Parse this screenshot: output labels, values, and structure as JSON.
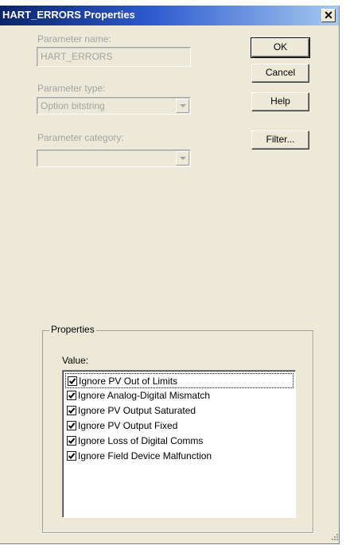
{
  "window": {
    "title": "HART_ERRORS Properties",
    "close_symbol": "✕"
  },
  "form": {
    "param_name_label": "Parameter name:",
    "param_name_value": "HART_ERRORS",
    "param_type_label": "Parameter type:",
    "param_type_value": "Option bitstring",
    "param_category_label": "Parameter category:",
    "param_category_value": ""
  },
  "buttons": {
    "ok": "OK",
    "cancel": "Cancel",
    "help": "Help",
    "filter": "Filter..."
  },
  "properties": {
    "group_title": "Properties",
    "value_label": "Value:",
    "items": [
      {
        "label": "Ignore PV Out of Limits",
        "checked": true
      },
      {
        "label": "Ignore Analog-Digital Mismatch",
        "checked": true
      },
      {
        "label": "Ignore PV Output Saturated",
        "checked": true
      },
      {
        "label": "Ignore PV Output Fixed",
        "checked": true
      },
      {
        "label": "Ignore Loss of Digital Comms",
        "checked": true
      },
      {
        "label": "Ignore Field Device Malfunction",
        "checked": true
      }
    ]
  },
  "colors": {
    "face": "#ece9d8",
    "title_start": "#0a246a",
    "title_end": "#a6caf0",
    "disabled_text": "#a3a3a3"
  }
}
